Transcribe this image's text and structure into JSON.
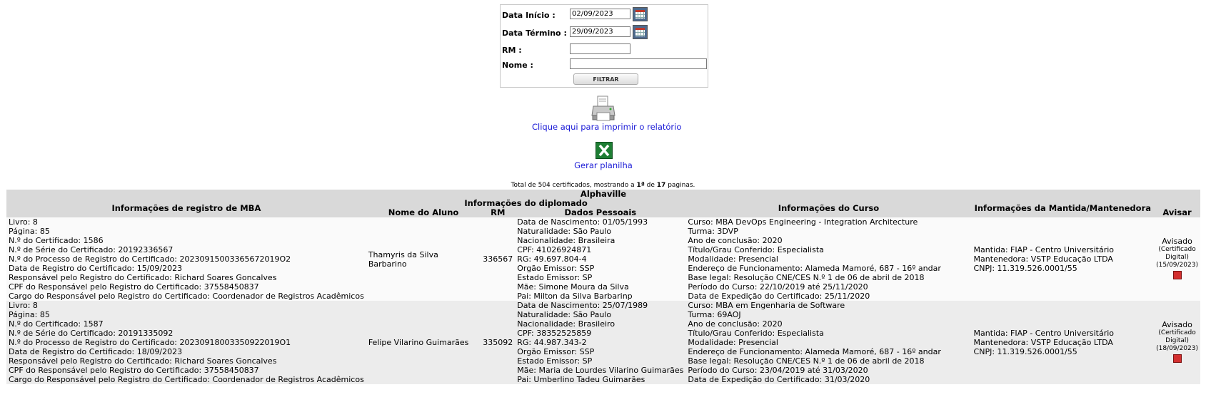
{
  "filter": {
    "start_label": "Data Início :",
    "start_value": "02/09/2023",
    "end_label": "Data Término :",
    "end_value": "29/09/2023",
    "rm_label": "RM :",
    "rm_value": "",
    "nome_label": "Nome :",
    "nome_value": "",
    "button": "FILTRAR"
  },
  "links": {
    "print": "Clique aqui para imprimir o relatório",
    "spreadsheet": "Gerar planilha"
  },
  "total": {
    "prefix": "Total de 504 certificados, mostrando a ",
    "page": "1ª",
    "middle": " de ",
    "pages": "17",
    "suffix": " paginas."
  },
  "table": {
    "title": "Alphaville",
    "col_mba": "Informações de registro de MBA",
    "group_diplomado": "Informações do diplomado",
    "col_nome": "Nome do Aluno",
    "col_rm": "RM",
    "col_dados": "Dados Pessoais",
    "col_curso": "Informações do Curso",
    "col_mantida": "Informações da Mantida/Mantenedora",
    "col_avisar": "Avisar",
    "rows": [
      {
        "mba": [
          "Livro: 8",
          "Página: 85",
          "N.º do Certificado: 1586",
          "N.º de Série do Certificado: 20192336567",
          "N.º do Processo de Registro do Certificado: 20230915003365672019O2",
          "Data de Registro do Certificado: 15/09/2023",
          "Responsável pelo Registro do Certificado: Richard Soares Goncalves",
          "CPF do Responsável pelo Registro do Certificado: 37558450837",
          "Cargo do Responsável pelo Registro do Certificado: Coordenador de Registros Acadêmicos"
        ],
        "nome": "Thamyris da Silva Barbarino",
        "rm": "336567",
        "dados": [
          "Data de Nascimento: 01/05/1993",
          "Naturalidade: São Paulo",
          "Nacionalidade: Brasileira",
          "CPF: 41026924871",
          "RG: 49.697.804-4",
          "Orgão Emissor: SSP",
          "Estado Emissor: SP",
          "Mãe: Simone Moura da Silva",
          "Pai: Milton da Silva Barbarinp"
        ],
        "curso": [
          "Curso: MBA DevOps Engineering - Integration Architecture",
          "Turma: 3DVP",
          "Ano de conclusão: 2020",
          "Título/Grau Conferido: Especialista",
          "Modalidade: Presencial",
          "Endereço de Funcionamento: Alameda Mamoré, 687 - 16º andar",
          "Base legal: Resolução CNE/CES N.º 1 de 06 de abril de 2018",
          "Período do Curso: 22/10/2019 até 25/11/2020",
          "Data de Expedição do Certificado: 25/11/2020"
        ],
        "mantida": [
          "Mantida: FIAP - Centro Universitário",
          "Mantenedora: VSTP Educação LTDA",
          "CNPJ: 11.319.526.0001/55"
        ],
        "avisado": "Avisado",
        "cert_line1": "(Certificado",
        "cert_line2": "Digital)",
        "cert_date": "(15/09/2023)"
      },
      {
        "mba": [
          "Livro: 8",
          "Página: 85",
          "N.º do Certificado: 1587",
          "N.º de Série do Certificado: 20191335092",
          "N.º do Processo de Registro do Certificado: 20230918003350922019O1",
          "Data de Registro do Certificado: 18/09/2023",
          "Responsável pelo Registro do Certificado: Richard Soares Goncalves",
          "CPF do Responsável pelo Registro do Certificado: 37558450837",
          "Cargo do Responsável pelo Registro do Certificado: Coordenador de Registros Acadêmicos"
        ],
        "nome": "Felipe Vilarino Guimarães",
        "rm": "335092",
        "dados": [
          "Data de Nascimento: 25/07/1989",
          "Naturalidade: São Paulo",
          "Nacionalidade: Brasileiro",
          "CPF: 38352525859",
          "RG: 44.987.343-2",
          "Orgão Emissor: SSP",
          "Estado Emissor: SP",
          "Mãe: Maria de Lourdes Vilarino Guimarães",
          "Pai: Umberlino Tadeu Guimarães"
        ],
        "curso": [
          "Curso: MBA em Engenharia de Software",
          "Turma: 69AOJ",
          "Ano de conclusão: 2020",
          "Título/Grau Conferido: Especialista",
          "Modalidade: Presencial",
          "Endereço de Funcionamento: Alameda Mamoré, 687 - 16º andar",
          "Base legal: Resolução CNE/CES N.º 1 de 06 de abril de 2018",
          "Período do Curso: 23/04/2019 até 31/03/2020",
          "Data de Expedição do Certificado: 31/03/2020"
        ],
        "mantida": [
          "Mantida: FIAP - Centro Universitário",
          "Mantenedora: VSTP Educação LTDA",
          "CNPJ: 11.319.526.0001/55"
        ],
        "avisado": "Avisado",
        "cert_line1": "(Certificado",
        "cert_line2": "Digital)",
        "cert_date": "(18/09/2023)"
      }
    ]
  }
}
